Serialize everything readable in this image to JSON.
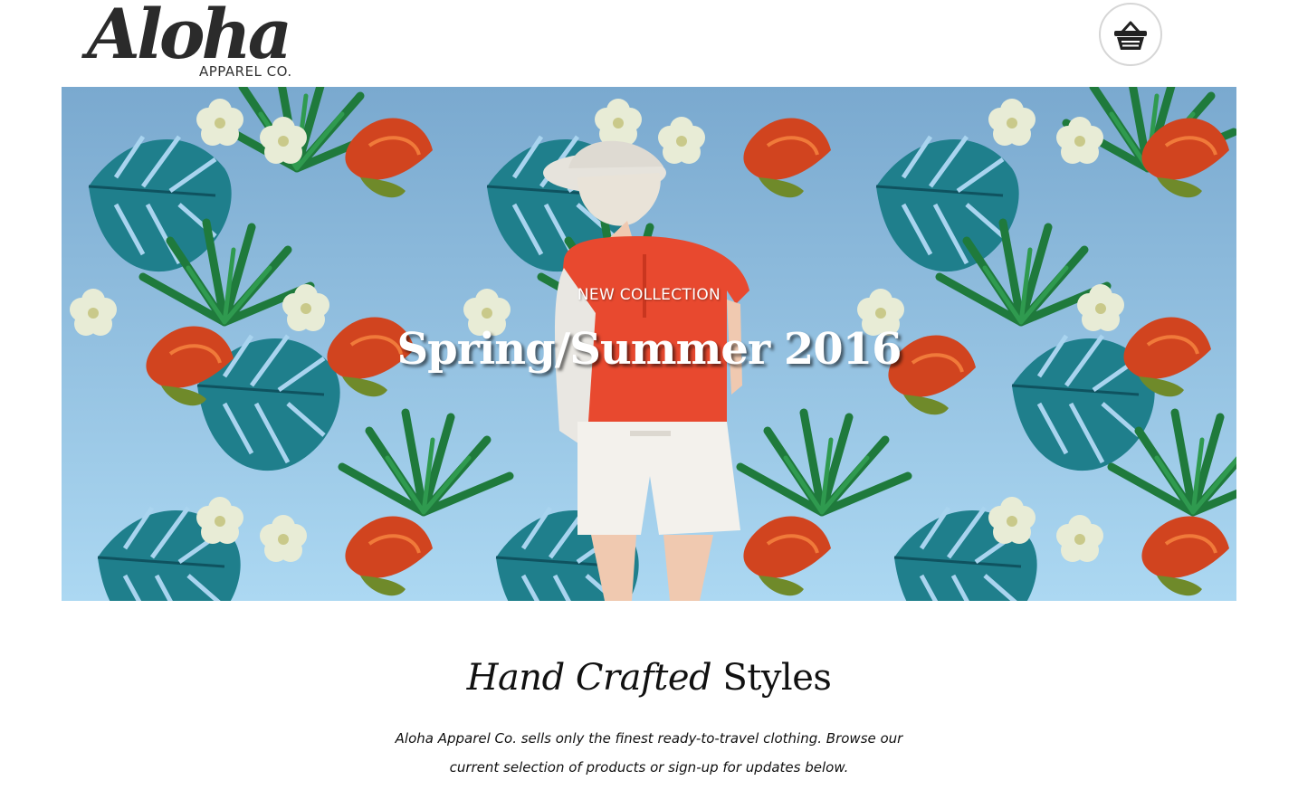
{
  "header": {
    "logo_word": "Aloha",
    "logo_sub": "APPAREL CO.",
    "cart_icon": "shopping-basket-icon"
  },
  "hero": {
    "kicker": "NEW COLLECTION",
    "title": "Spring/Summer 2016"
  },
  "intro": {
    "heading_italic": "Hand Crafted",
    "heading_plain": "Styles",
    "text": "Aloha Apparel Co. sells only the finest ready-to-travel clothing. Browse our current selection of products or sign-up for updates below."
  },
  "colors": {
    "sky": "#a9d4ef",
    "leaf_teal": "#1f7f8c",
    "leaf_green": "#1f7a3c",
    "flower_red": "#d1441f",
    "flower_cream": "#e8ecd6",
    "shirt": "#e8492f"
  }
}
